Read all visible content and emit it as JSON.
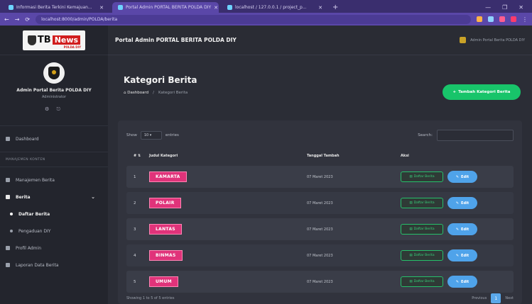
{
  "browser": {
    "tabs": [
      {
        "title": "Informasi Berita Terkini Kemajuan...",
        "active": false
      },
      {
        "title": "Portal Admin PORTAL BERITA POLDA DIY",
        "active": true
      },
      {
        "title": "localhost / 127.0.0.1 / project_p...",
        "active": false
      }
    ],
    "new_tab": "+",
    "window_controls": [
      "—",
      "❐",
      "✕"
    ],
    "url": "localhost:8000/admin/POLDA/berita"
  },
  "sidebar": {
    "logo_tb": "TB",
    "logo_news": "News",
    "logo_sub": "POLDA DIY",
    "user_name": "Admin Portal Berita POLDA DIY",
    "user_role": "Administrator",
    "user_icons": "⚙ ⎋",
    "items": [
      {
        "label": "Dashboard"
      },
      {
        "label": "Manajemen Berita"
      },
      {
        "label": "Berita"
      },
      {
        "label": "Daftar Berita"
      },
      {
        "label": "Pengaduan DIY"
      },
      {
        "label": "Profil Admin"
      },
      {
        "label": "Laporan Data Berita"
      }
    ],
    "header_label": "MANAJEMEN KONTEN",
    "berita_chevron": "⌄",
    "accent": "#23252d"
  },
  "topbar": {
    "title": "Portal Admin PORTAL BERITA POLDA DIY",
    "user": "Admin Portal Berita POLDA DIY"
  },
  "page": {
    "title": "Kategori Berita",
    "breadcrumb_home": "Dashboard",
    "breadcrumb_sep": "/",
    "breadcrumb_current": "Kategori Berita",
    "add_button": "Tambah Kategori Berita",
    "add_button_color": "#18c46a"
  },
  "table": {
    "show_label": "Show",
    "show_value": "10",
    "entries_label": "entries",
    "search_label": "Search:",
    "search_value": "",
    "headers": {
      "no": "#",
      "name": "Judul Kategori",
      "date": "Tanggal Tambah",
      "action": "Aksi"
    },
    "rows": [
      {
        "no": "1",
        "name": "KAMARTA",
        "date": "07 Maret 2023"
      },
      {
        "no": "2",
        "name": "POLAIR",
        "date": "07 Maret 2023"
      },
      {
        "no": "3",
        "name": "LANTAS",
        "date": "07 Maret 2023"
      },
      {
        "no": "4",
        "name": "BINMAS",
        "date": "07 Maret 2023"
      },
      {
        "no": "5",
        "name": "UMUM",
        "date": "07 Maret 2023"
      }
    ],
    "list_button": "Daftar Berita",
    "edit_button": "Edit",
    "footer_info": "Showing 1 to 5 of 5 entries",
    "prev": "Previous",
    "page": "1",
    "next": "Next",
    "category_color": "#e0337a",
    "edit_color": "#4fa3ea"
  }
}
